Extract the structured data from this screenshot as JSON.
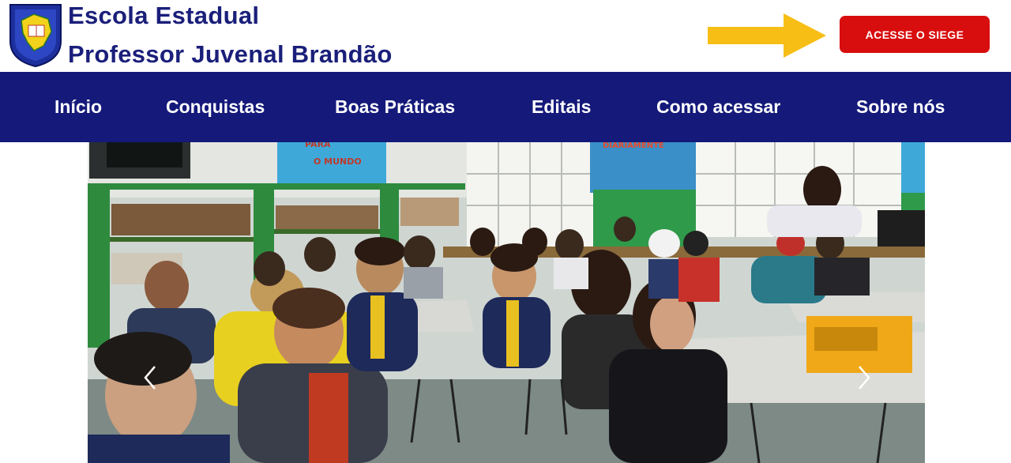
{
  "header": {
    "school_name_line1": "Escola Estadual",
    "school_name_line2": "Professor Juvenal Brandão",
    "logo_icon": "school-crest-icon",
    "arrow_icon": "arrow-right-icon",
    "cta_label": "ACESSE O SIEGE"
  },
  "nav": {
    "items": [
      {
        "label": "Início"
      },
      {
        "label": "Conquistas"
      },
      {
        "label": "Boas Práticas"
      },
      {
        "label": "Editais"
      },
      {
        "label": "Como acessar"
      },
      {
        "label": "Sobre nós"
      }
    ]
  },
  "hero": {
    "banner_left_text": "O MUNDO",
    "banner_left_top": "PARA",
    "banner_right_text": "DIARIAMENTE",
    "prev_icon": "chevron-left-icon",
    "next_icon": "chevron-right-icon"
  },
  "colors": {
    "brand_blue": "#14197a",
    "cta_red": "#d80d0d",
    "arrow_yellow": "#f7be16"
  }
}
